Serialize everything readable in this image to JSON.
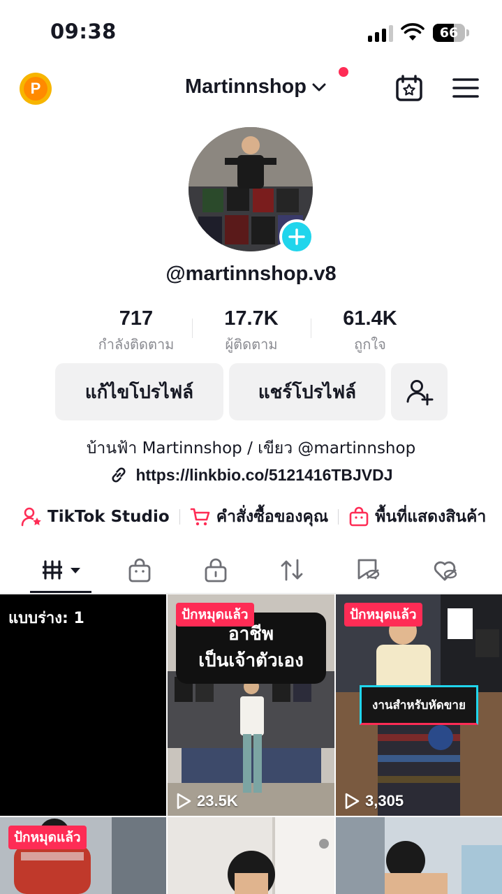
{
  "status_bar": {
    "time": "09:38",
    "battery": "66",
    "battery_level": 0.66
  },
  "header": {
    "account_name": "Martinnshop",
    "coin_letter": "P"
  },
  "profile": {
    "username": "@martinnshop.v8",
    "stats": [
      {
        "value": "717",
        "label": "กำลังติดตาม"
      },
      {
        "value": "17.7K",
        "label": "ผู้ติดตาม"
      },
      {
        "value": "61.4K",
        "label": "ถูกใจ"
      }
    ],
    "buttons": {
      "edit": "แก้ไขโปรไฟล์",
      "share": "แชร์โปรไฟล์"
    },
    "bio": "บ้านฟ้า Martinnshop / เขียว @martinnshop",
    "link": "https://linkbio.co/5121416TBJVDJ"
  },
  "shortcuts": [
    {
      "label": "TikTok Studio",
      "icon": "person-star-icon"
    },
    {
      "label": "คำสั่งซื้อของคุณ",
      "icon": "cart-icon"
    },
    {
      "label": "พื้นที่แสดงสินค้า",
      "icon": "shop-bag-icon"
    }
  ],
  "tabs": [
    {
      "icon": "videos-grid-icon",
      "active": true
    },
    {
      "icon": "shop-icon"
    },
    {
      "icon": "private-lock-icon"
    },
    {
      "icon": "repost-icon"
    },
    {
      "icon": "favorites-hidden-icon"
    },
    {
      "icon": "liked-hidden-icon"
    }
  ],
  "grid": {
    "draft_label": "แบบร่าง: 1",
    "pinned_label": "ปักหมุดแล้ว",
    "videos": [
      {
        "caption_line1": "อาชีพ",
        "caption_line2": "เป็นเจ้าตัวเอง",
        "views": "23.5K",
        "pinned": true
      },
      {
        "tag": "งานสำหรับหัดขาย",
        "views": "3,305",
        "pinned": true
      },
      {
        "pinned": true
      },
      {
        "pinned": false
      },
      {
        "pinned": false
      }
    ]
  },
  "colors": {
    "accent": "#fe2c55",
    "cyan": "#20d5ec",
    "text": "#161823",
    "muted": "#8a8b91"
  }
}
